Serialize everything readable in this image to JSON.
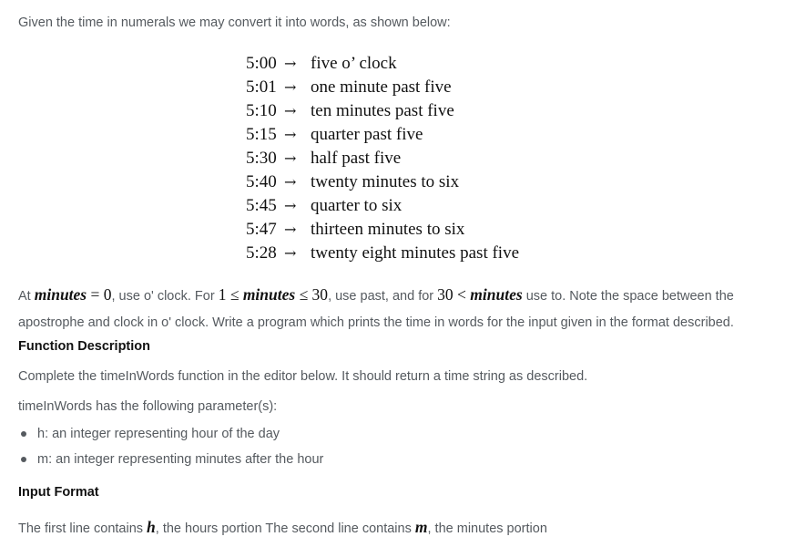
{
  "intro": "Given the time in numerals we may convert it into words, as shown below:",
  "examples": [
    {
      "time": "5:00",
      "arrow": "→",
      "words": "five o’ clock"
    },
    {
      "time": "5:01",
      "arrow": "→",
      "words": "one minute past five"
    },
    {
      "time": "5:10",
      "arrow": "→",
      "words": "ten minutes past five"
    },
    {
      "time": "5:15",
      "arrow": "→",
      "words": "quarter past five"
    },
    {
      "time": "5:30",
      "arrow": "→",
      "words": "half past five"
    },
    {
      "time": "5:40",
      "arrow": "→",
      "words": "twenty minutes to six"
    },
    {
      "time": "5:45",
      "arrow": "→",
      "words": "quarter to six"
    },
    {
      "time": "5:47",
      "arrow": "→",
      "words": "thirteen minutes to six"
    },
    {
      "time": "5:28",
      "arrow": "→",
      "words": "twenty eight minutes past five"
    }
  ],
  "rule": {
    "t1": "At ",
    "m1_var": "minutes",
    "m1_rest": " = 0",
    "t2": ", use o' clock. For ",
    "m2_a": "1 ≤ ",
    "m2_var": "minutes",
    "m2_b": " ≤ 30",
    "t3": ", use past, and for ",
    "m3_a": "30 < ",
    "m3_var": "minutes",
    "t4": " use to. Note the space between the apostrophe and clock in o' clock. Write a program which prints the time in words for the input given in the format described."
  },
  "function_description": {
    "heading": "Function Description",
    "text": "Complete the timeInWords function in the editor below. It should return a time string as described.",
    "params_intro": "timeInWords has the following parameter(s):",
    "params": [
      "h: an integer representing hour of the day",
      "m: an integer representing minutes after the hour"
    ]
  },
  "input_format": {
    "heading": "Input Format",
    "t1": "The first line contains ",
    "var_h": "h",
    "t2": ", the hours portion The second line contains ",
    "var_m": "m",
    "t3": ", the minutes portion"
  }
}
